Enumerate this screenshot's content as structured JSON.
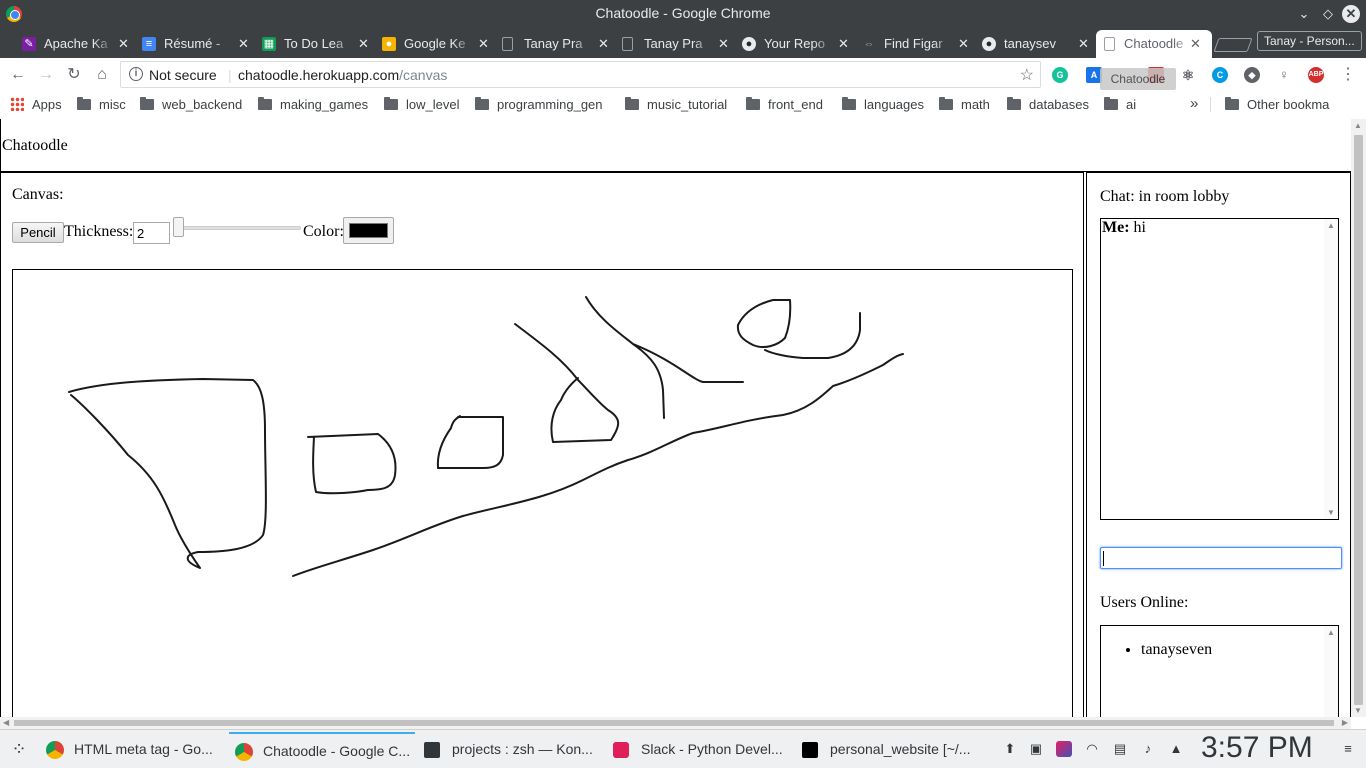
{
  "window": {
    "title": "Chatoodle - Google Chrome"
  },
  "tabs": [
    {
      "label": "Apache Ka",
      "icon": "apache-kafka-icon",
      "color": "#7b1fa2"
    },
    {
      "label": "Résumé -",
      "icon": "google-docs-icon",
      "color": "#4285f4"
    },
    {
      "label": "To Do Lea",
      "icon": "google-sheets-icon",
      "color": "#0f9d58"
    },
    {
      "label": "Google Ke",
      "icon": "google-keep-icon",
      "color": "#f4b400"
    },
    {
      "label": "Tanay Pra",
      "icon": "document-icon",
      "color": "#9aa0a6"
    },
    {
      "label": "Tanay Pra",
      "icon": "document-icon",
      "color": "#9aa0a6"
    },
    {
      "label": "Your Repo",
      "icon": "github-icon",
      "color": "#24292e"
    },
    {
      "label": "Find Figar",
      "icon": "link-icon",
      "color": "#9aa0a6"
    },
    {
      "label": "tanaysev",
      "icon": "github-icon",
      "color": "#24292e"
    },
    {
      "label": "Chatoodle",
      "icon": "document-icon",
      "color": "#9aa0a6",
      "active": true
    }
  ],
  "profile": {
    "label": "Tanay - Person..."
  },
  "omnibox": {
    "security": "Not secure",
    "host": "chatoodle.herokuapp.com",
    "path": "/canvas"
  },
  "tooltip": "Chatoodle",
  "bookmarks": {
    "apps": "Apps",
    "folders": [
      "misc",
      "web_backend",
      "making_games",
      "low_level",
      "programming_gen",
      "music_tutorial",
      "front_end",
      "languages",
      "math",
      "databases",
      "ai"
    ],
    "overflow": "»",
    "other": "Other bookmarks"
  },
  "page": {
    "app_title": "Chatoodle",
    "canvas": {
      "label": "Canvas:",
      "pencil_button": "Pencil",
      "thickness_label": "Thickness:",
      "thickness_value": "2",
      "thickness_slider_fraction": 0.0,
      "color_label": "Color:",
      "color_value": "#000000"
    },
    "chat": {
      "label": "Chat: in room lobby",
      "messages": [
        {
          "sender": "Me:",
          "text": "hi"
        }
      ],
      "input_value": "",
      "users_label": "Users Online:",
      "users": [
        "tanayseven"
      ]
    }
  },
  "taskbar": {
    "tasks": [
      {
        "label": "HTML meta tag - Go...",
        "icon": "chrome-icon"
      },
      {
        "label": "Chatoodle - Google C...",
        "icon": "chrome-icon",
        "active": true
      },
      {
        "label": "projects : zsh — Kon...",
        "icon": "terminal-icon"
      },
      {
        "label": "Slack - Python Devel...",
        "icon": "slack-icon"
      },
      {
        "label": "personal_website [~/...",
        "icon": "webstorm-icon"
      }
    ],
    "clock": "3:57 PM"
  }
}
